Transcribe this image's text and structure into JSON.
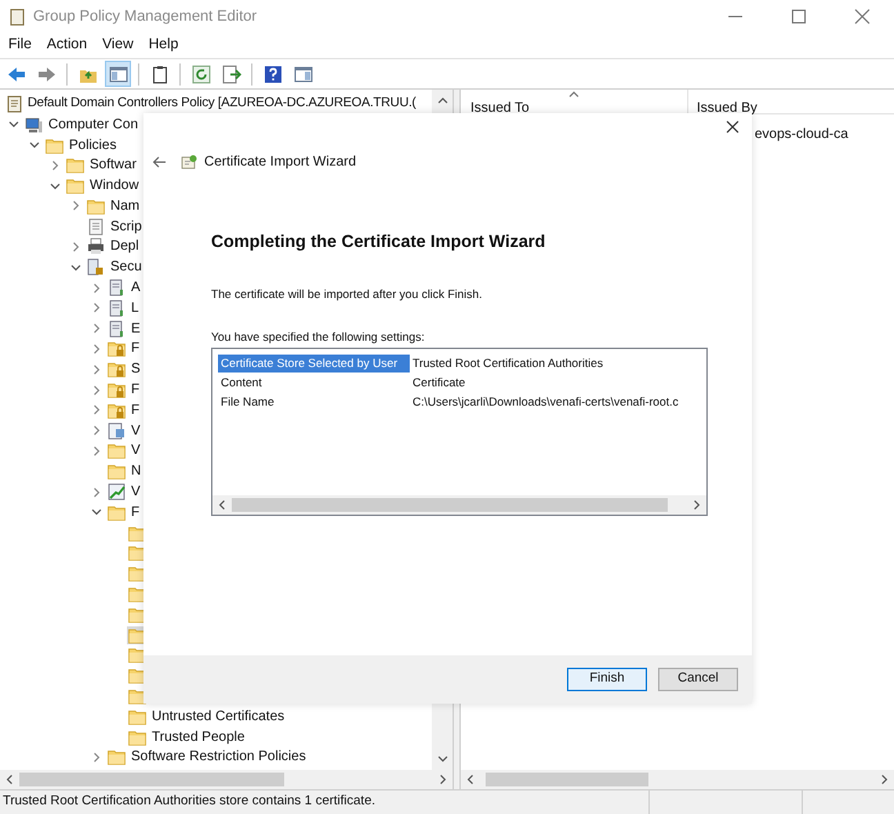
{
  "window": {
    "title": "Group Policy Management Editor"
  },
  "menu": [
    {
      "label": "File"
    },
    {
      "label": "Action"
    },
    {
      "label": "View"
    },
    {
      "label": "Help"
    }
  ],
  "toolbar": [
    {
      "kind": "back",
      "pressed": false
    },
    {
      "kind": "forward",
      "pressed": false
    },
    {
      "kind": "separator"
    },
    {
      "kind": "up",
      "pressed": false
    },
    {
      "kind": "tree",
      "pressed": true
    },
    {
      "kind": "separator"
    },
    {
      "kind": "clipboard",
      "pressed": false
    },
    {
      "kind": "separator"
    },
    {
      "kind": "refresh",
      "pressed": false
    },
    {
      "kind": "export",
      "pressed": false
    },
    {
      "kind": "separator"
    },
    {
      "kind": "help",
      "pressed": false
    },
    {
      "kind": "pane",
      "pressed": false
    }
  ],
  "tree": {
    "label": "Default Domain Controllers Policy [AZUREOA-DC.AZUREOA.TRUU.(",
    "kind": "policy",
    "children": [
      {
        "label": "Computer Con",
        "kind": "computer",
        "expanded": true,
        "selected": false,
        "children": [
          {
            "label": "Policies",
            "kind": "folder",
            "expanded": true,
            "selected": false,
            "children": [
              {
                "label": "Softwar",
                "kind": "folder",
                "expanded": false,
                "selected": false
              },
              {
                "label": "Window",
                "kind": "folder",
                "expanded": true,
                "selected": false,
                "children": [
                  {
                    "label": "Nam",
                    "kind": "folder",
                    "expanded": false,
                    "selected": false
                  },
                  {
                    "label": "Scrip",
                    "kind": "document",
                    "selected": false
                  },
                  {
                    "label": "Depl",
                    "kind": "printer",
                    "expanded": false,
                    "selected": false
                  },
                  {
                    "label": "Secu",
                    "kind": "security",
                    "expanded": true,
                    "selected": false,
                    "children": [
                      {
                        "label": "A",
                        "kind": "server",
                        "expanded": false,
                        "selected": false
                      },
                      {
                        "label": "L",
                        "kind": "server",
                        "expanded": false,
                        "selected": false
                      },
                      {
                        "label": "E",
                        "kind": "server",
                        "expanded": false,
                        "selected": false
                      },
                      {
                        "label": "F",
                        "kind": "lockfolder",
                        "expanded": false,
                        "selected": false
                      },
                      {
                        "label": "S",
                        "kind": "lockfolder",
                        "expanded": false,
                        "selected": false
                      },
                      {
                        "label": "F",
                        "kind": "lockfolder",
                        "expanded": false,
                        "selected": false
                      },
                      {
                        "label": "F",
                        "kind": "lockfolder",
                        "expanded": false,
                        "selected": false
                      },
                      {
                        "label": "V",
                        "kind": "monitor",
                        "expanded": false,
                        "selected": false
                      },
                      {
                        "label": "V",
                        "kind": "folder",
                        "expanded": false,
                        "selected": false
                      },
                      {
                        "label": "N",
                        "kind": "folder",
                        "selected": false
                      },
                      {
                        "label": "V",
                        "kind": "chart",
                        "expanded": false,
                        "selected": false
                      },
                      {
                        "label": "F",
                        "kind": "folder",
                        "expanded": true,
                        "selected": false,
                        "children": [
                          {
                            "kind": "folder",
                            "selected": false
                          },
                          {
                            "kind": "folder",
                            "selected": false
                          },
                          {
                            "kind": "folder",
                            "selected": false
                          },
                          {
                            "kind": "folder",
                            "selected": false
                          },
                          {
                            "kind": "folder",
                            "selected": false
                          },
                          {
                            "kind": "folder",
                            "selected": true
                          },
                          {
                            "kind": "folder",
                            "selected": false
                          },
                          {
                            "kind": "folder",
                            "selected": false
                          },
                          {
                            "kind": "folder",
                            "selected": false
                          },
                          {
                            "label": "Untrusted Certificates",
                            "kind": "folder",
                            "selected": false
                          },
                          {
                            "label": "Trusted People",
                            "kind": "folder",
                            "selected": false
                          }
                        ]
                      },
                      {
                        "label": "Software Restriction Policies",
                        "kind": "folder",
                        "expanded": false,
                        "selected": false
                      }
                    ]
                  }
                ]
              }
            ]
          }
        ]
      }
    ]
  },
  "list": {
    "columns": [
      {
        "label": "Issued To"
      },
      {
        "label": "Issued By"
      }
    ],
    "rows": [
      {
        "issued_by": "evops-cloud-ca"
      }
    ]
  },
  "wizard": {
    "title": "Certificate Import Wizard",
    "heading": "Completing the Certificate Import Wizard",
    "message": "The certificate will be imported after you click Finish.",
    "settings_label": "You have specified the following settings:",
    "settings": [
      {
        "name": "Certificate Store Selected by User",
        "value": "Trusted Root Certification Authorities",
        "selected": true
      },
      {
        "name": "Content",
        "value": "Certificate",
        "selected": false
      },
      {
        "name": "File Name",
        "value": "C:\\Users\\jcarli\\Downloads\\venafi-certs\\venafi-root.c",
        "selected": false
      }
    ],
    "buttons": [
      {
        "label": "Finish",
        "default": true
      },
      {
        "label": "Cancel",
        "default": false
      }
    ]
  },
  "status_bar": {
    "text": "Trusted Root Certification Authorities store contains 1 certificate."
  }
}
